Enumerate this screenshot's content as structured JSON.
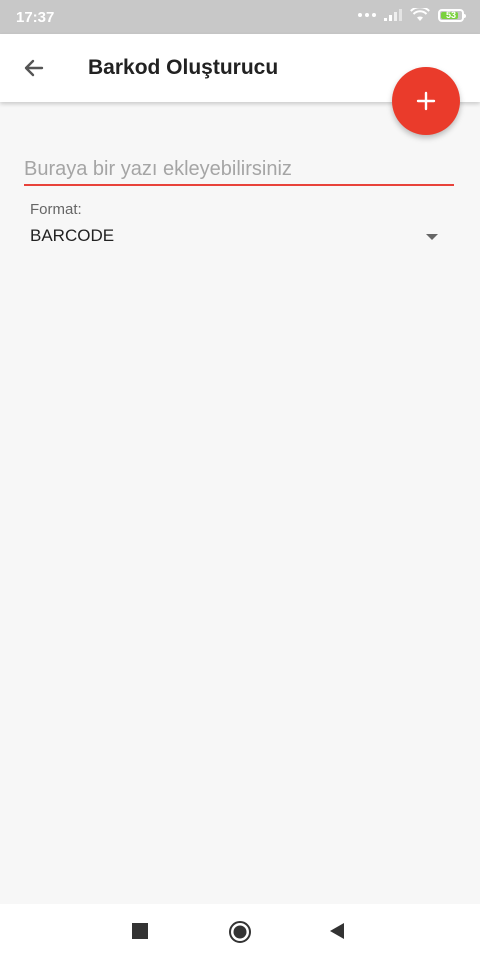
{
  "status_bar": {
    "time": "17:37",
    "battery": "53"
  },
  "app_bar": {
    "title": "Barkod Oluşturucu"
  },
  "input": {
    "placeholder": "Buraya bir yazı ekleyebilirsiniz",
    "value": ""
  },
  "format": {
    "label": "Format:",
    "selected": "BARCODE"
  },
  "colors": {
    "accent": "#ea3b2b",
    "underline": "#e8423a",
    "status_bar": "#c8c8c8",
    "background": "#f7f7f7"
  },
  "icons": {
    "back": "arrow-left-icon",
    "fab": "plus-icon",
    "dropdown": "caret-down-icon",
    "nav_recents": "square-icon",
    "nav_home": "circle-icon",
    "nav_back": "triangle-left-icon"
  }
}
